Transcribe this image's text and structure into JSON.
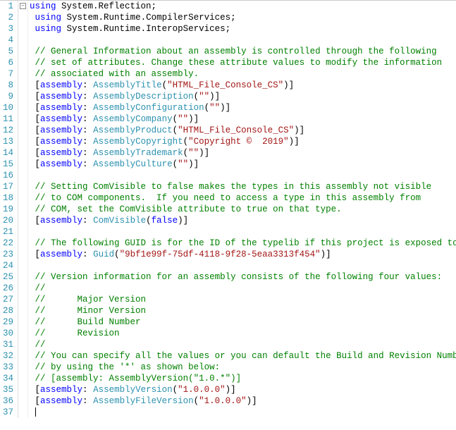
{
  "editor": {
    "fold_glyph": "−",
    "lines": [
      {
        "num": 1,
        "segs": [
          [
            "kw",
            "using"
          ],
          [
            "txt",
            " System.Reflection;"
          ]
        ]
      },
      {
        "num": 2,
        "segs": [
          [
            "txt",
            " "
          ],
          [
            "kw",
            "using"
          ],
          [
            "txt",
            " System.Runtime.CompilerServices;"
          ]
        ]
      },
      {
        "num": 3,
        "segs": [
          [
            "txt",
            " "
          ],
          [
            "kw",
            "using"
          ],
          [
            "txt",
            " System.Runtime.InteropServices;"
          ]
        ]
      },
      {
        "num": 4,
        "segs": []
      },
      {
        "num": 5,
        "segs": [
          [
            "txt",
            " "
          ],
          [
            "comment",
            "// General Information about an assembly is controlled through the following"
          ]
        ]
      },
      {
        "num": 6,
        "segs": [
          [
            "txt",
            " "
          ],
          [
            "comment",
            "// set of attributes. Change these attribute values to modify the information"
          ]
        ]
      },
      {
        "num": 7,
        "segs": [
          [
            "txt",
            " "
          ],
          [
            "comment",
            "// associated with an assembly."
          ]
        ]
      },
      {
        "num": 8,
        "segs": [
          [
            "txt",
            " ["
          ],
          [
            "kw",
            "assembly"
          ],
          [
            "txt",
            ": "
          ],
          [
            "type",
            "AssemblyTitle"
          ],
          [
            "txt",
            "("
          ],
          [
            "str",
            "\"HTML_File_Console_CS\""
          ],
          [
            "txt",
            ")]"
          ]
        ]
      },
      {
        "num": 9,
        "segs": [
          [
            "txt",
            " ["
          ],
          [
            "kw",
            "assembly"
          ],
          [
            "txt",
            ": "
          ],
          [
            "type",
            "AssemblyDescription"
          ],
          [
            "txt",
            "("
          ],
          [
            "str",
            "\"\""
          ],
          [
            "txt",
            ")]"
          ]
        ]
      },
      {
        "num": 10,
        "segs": [
          [
            "txt",
            " ["
          ],
          [
            "kw",
            "assembly"
          ],
          [
            "txt",
            ": "
          ],
          [
            "type",
            "AssemblyConfiguration"
          ],
          [
            "txt",
            "("
          ],
          [
            "str",
            "\"\""
          ],
          [
            "txt",
            ")]"
          ]
        ]
      },
      {
        "num": 11,
        "segs": [
          [
            "txt",
            " ["
          ],
          [
            "kw",
            "assembly"
          ],
          [
            "txt",
            ": "
          ],
          [
            "type",
            "AssemblyCompany"
          ],
          [
            "txt",
            "("
          ],
          [
            "str",
            "\"\""
          ],
          [
            "txt",
            ")]"
          ]
        ]
      },
      {
        "num": 12,
        "segs": [
          [
            "txt",
            " ["
          ],
          [
            "kw",
            "assembly"
          ],
          [
            "txt",
            ": "
          ],
          [
            "type",
            "AssemblyProduct"
          ],
          [
            "txt",
            "("
          ],
          [
            "str",
            "\"HTML_File_Console_CS\""
          ],
          [
            "txt",
            ")]"
          ]
        ]
      },
      {
        "num": 13,
        "segs": [
          [
            "txt",
            " ["
          ],
          [
            "kw",
            "assembly"
          ],
          [
            "txt",
            ": "
          ],
          [
            "type",
            "AssemblyCopyright"
          ],
          [
            "txt",
            "("
          ],
          [
            "str",
            "\"Copyright ©  2019\""
          ],
          [
            "txt",
            ")]"
          ]
        ]
      },
      {
        "num": 14,
        "segs": [
          [
            "txt",
            " ["
          ],
          [
            "kw",
            "assembly"
          ],
          [
            "txt",
            ": "
          ],
          [
            "type",
            "AssemblyTrademark"
          ],
          [
            "txt",
            "("
          ],
          [
            "str",
            "\"\""
          ],
          [
            "txt",
            ")]"
          ]
        ]
      },
      {
        "num": 15,
        "segs": [
          [
            "txt",
            " ["
          ],
          [
            "kw",
            "assembly"
          ],
          [
            "txt",
            ": "
          ],
          [
            "type",
            "AssemblyCulture"
          ],
          [
            "txt",
            "("
          ],
          [
            "str",
            "\"\""
          ],
          [
            "txt",
            ")]"
          ]
        ]
      },
      {
        "num": 16,
        "segs": []
      },
      {
        "num": 17,
        "segs": [
          [
            "txt",
            " "
          ],
          [
            "comment",
            "// Setting ComVisible to false makes the types in this assembly not visible"
          ]
        ]
      },
      {
        "num": 18,
        "segs": [
          [
            "txt",
            " "
          ],
          [
            "comment",
            "// to COM components.  If you need to access a type in this assembly from"
          ]
        ]
      },
      {
        "num": 19,
        "segs": [
          [
            "txt",
            " "
          ],
          [
            "comment",
            "// COM, set the ComVisible attribute to true on that type."
          ]
        ]
      },
      {
        "num": 20,
        "segs": [
          [
            "txt",
            " ["
          ],
          [
            "kw",
            "assembly"
          ],
          [
            "txt",
            ": "
          ],
          [
            "type",
            "ComVisible"
          ],
          [
            "txt",
            "("
          ],
          [
            "kw",
            "false"
          ],
          [
            "txt",
            ")]"
          ]
        ]
      },
      {
        "num": 21,
        "segs": []
      },
      {
        "num": 22,
        "segs": [
          [
            "txt",
            " "
          ],
          [
            "comment",
            "// The following GUID is for the ID of the typelib if this project is exposed to COM"
          ]
        ]
      },
      {
        "num": 23,
        "segs": [
          [
            "txt",
            " ["
          ],
          [
            "kw",
            "assembly"
          ],
          [
            "txt",
            ": "
          ],
          [
            "type",
            "Guid"
          ],
          [
            "txt",
            "("
          ],
          [
            "str",
            "\"9bf1e99f-75df-4118-9f28-5eaa3313f454\""
          ],
          [
            "txt",
            ")]"
          ]
        ]
      },
      {
        "num": 24,
        "segs": []
      },
      {
        "num": 25,
        "segs": [
          [
            "txt",
            " "
          ],
          [
            "comment",
            "// Version information for an assembly consists of the following four values:"
          ]
        ]
      },
      {
        "num": 26,
        "segs": [
          [
            "txt",
            " "
          ],
          [
            "comment",
            "//"
          ]
        ]
      },
      {
        "num": 27,
        "segs": [
          [
            "txt",
            " "
          ],
          [
            "comment",
            "//      Major Version"
          ]
        ]
      },
      {
        "num": 28,
        "segs": [
          [
            "txt",
            " "
          ],
          [
            "comment",
            "//      Minor Version"
          ]
        ]
      },
      {
        "num": 29,
        "segs": [
          [
            "txt",
            " "
          ],
          [
            "comment",
            "//      Build Number"
          ]
        ]
      },
      {
        "num": 30,
        "segs": [
          [
            "txt",
            " "
          ],
          [
            "comment",
            "//      Revision"
          ]
        ]
      },
      {
        "num": 31,
        "segs": [
          [
            "txt",
            " "
          ],
          [
            "comment",
            "//"
          ]
        ]
      },
      {
        "num": 32,
        "segs": [
          [
            "txt",
            " "
          ],
          [
            "comment",
            "// You can specify all the values or you can default the Build and Revision Numbers"
          ]
        ]
      },
      {
        "num": 33,
        "segs": [
          [
            "txt",
            " "
          ],
          [
            "comment",
            "// by using the '*' as shown below:"
          ]
        ]
      },
      {
        "num": 34,
        "segs": [
          [
            "txt",
            " "
          ],
          [
            "comment",
            "// [assembly: AssemblyVersion(\"1.0.*\")]"
          ]
        ]
      },
      {
        "num": 35,
        "segs": [
          [
            "txt",
            " ["
          ],
          [
            "kw",
            "assembly"
          ],
          [
            "txt",
            ": "
          ],
          [
            "type",
            "AssemblyVersion"
          ],
          [
            "txt",
            "("
          ],
          [
            "str",
            "\"1.0.0.0\""
          ],
          [
            "txt",
            ")]"
          ]
        ]
      },
      {
        "num": 36,
        "segs": [
          [
            "txt",
            " ["
          ],
          [
            "kw",
            "assembly"
          ],
          [
            "txt",
            ": "
          ],
          [
            "type",
            "AssemblyFileVersion"
          ],
          [
            "txt",
            "("
          ],
          [
            "str",
            "\"1.0.0.0\""
          ],
          [
            "txt",
            ")]"
          ]
        ]
      },
      {
        "num": 37,
        "segs": [
          [
            "txt",
            " "
          ]
        ],
        "caret": true
      }
    ]
  }
}
